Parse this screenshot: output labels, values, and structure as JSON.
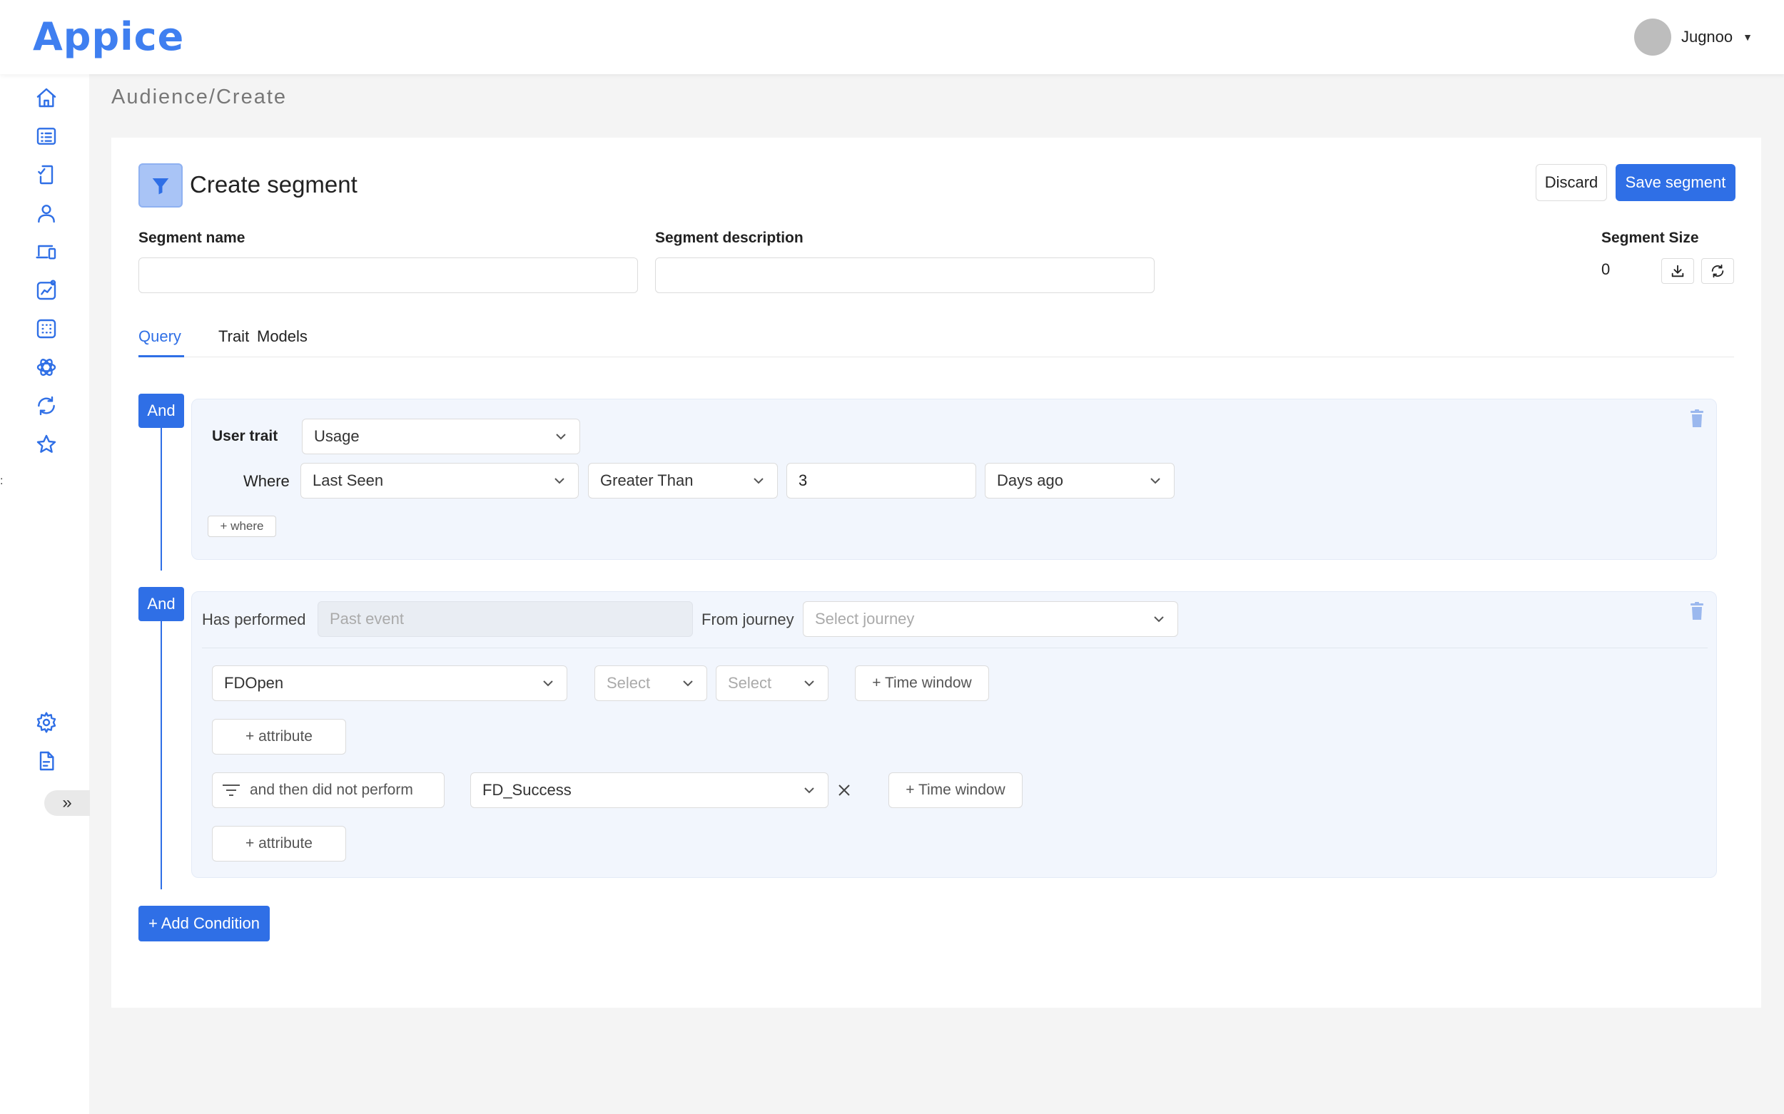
{
  "app": {
    "logo": "Appice",
    "user_name": "Jugnoo",
    "brand_color": "#2f6fe6"
  },
  "sidebar": {
    "items": [
      {
        "icon": "home-icon"
      },
      {
        "icon": "list-icon"
      },
      {
        "icon": "mobile-check-icon"
      },
      {
        "icon": "user-icon"
      },
      {
        "icon": "devices-icon"
      },
      {
        "icon": "analytics-icon"
      },
      {
        "icon": "grid-icon"
      },
      {
        "icon": "atom-icon"
      },
      {
        "icon": "sync-icon"
      },
      {
        "icon": "star-icon"
      }
    ],
    "bottom_items": [
      {
        "icon": "gear-icon"
      },
      {
        "icon": "document-icon"
      }
    ],
    "expand_label": "»",
    "edge_marker": ":"
  },
  "breadcrumb": "Audience/Create",
  "header": {
    "title": "Create segment",
    "discard_label": "Discard",
    "save_label": "Save segment"
  },
  "form": {
    "segment_name_label": "Segment name",
    "segment_name_value": "",
    "segment_description_label": "Segment description",
    "segment_description_value": "",
    "segment_size_label": "Segment Size",
    "segment_size_value": "0"
  },
  "tabs": [
    {
      "label": "Query",
      "active": true
    },
    {
      "label": "Trait",
      "active": false
    },
    {
      "label": "Models",
      "active": false
    }
  ],
  "conditions": [
    {
      "operator": "And",
      "type": "user_trait",
      "user_trait_label": "User trait",
      "user_trait_value": "Usage",
      "where_label": "Where",
      "where_field": "Last Seen",
      "where_operator": "Greater Than",
      "where_value": "3",
      "where_unit": "Days ago",
      "add_where_label": "+ where"
    },
    {
      "operator": "And",
      "type": "event",
      "has_performed_label": "Has performed",
      "past_event_placeholder": "Past event",
      "from_journey_label": "From journey",
      "journey_placeholder": "Select journey",
      "event_value": "FDOpen",
      "select_1": "Select",
      "select_2": "Select",
      "time_window_label": "+ Time window",
      "add_attribute_label": "+ attribute",
      "then_label": "and then did not perform",
      "then_event_value": "FD_Success",
      "then_time_window_label": "+ Time window",
      "then_add_attribute_label": "+ attribute"
    }
  ],
  "add_condition_label": "+ Add Condition"
}
